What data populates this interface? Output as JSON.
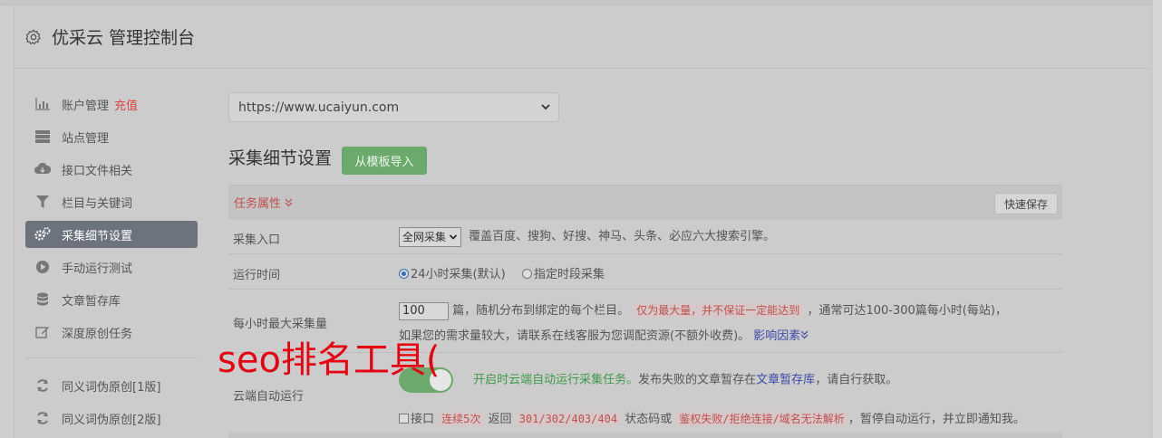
{
  "header": {
    "title": "优采云 管理控制台"
  },
  "sidebar": {
    "items": [
      {
        "label": "账户管理",
        "extra": "充值"
      },
      {
        "label": "站点管理"
      },
      {
        "label": "接口文件相关"
      },
      {
        "label": "栏目与关键词"
      },
      {
        "label": "采集细节设置"
      },
      {
        "label": "手动运行测试"
      },
      {
        "label": "文章暂存库"
      },
      {
        "label": "深度原创任务"
      },
      {
        "label": "同义词伪原创[1版]"
      },
      {
        "label": "同义词伪原创[2版]"
      }
    ]
  },
  "site_select": {
    "value": "https://www.ucaiyun.com"
  },
  "section": {
    "title": "采集细节设置",
    "import_label": "从模板导入"
  },
  "table": {
    "header_label": "任务属性",
    "quick_save": "快速保存",
    "rows": {
      "entry": {
        "label": "采集入口",
        "select_value": "全网采集",
        "desc": "覆盖百度、搜狗、好搜、神马、头条、必应六大搜索引擎。"
      },
      "runtime": {
        "label": "运行时间",
        "opt1": "24小时采集(默认)",
        "opt2": "指定时段采集"
      },
      "max_per_hour": {
        "label": "每小时最大采集量",
        "input_value": "100",
        "text1": "篇，随机分布到绑定的每个栏目。",
        "note": "仅为最大量，并不保证一定能达到",
        "text2": "，通常可达100-300篇每小时(每站)，",
        "text3": "如果您的需求量较大，请联系在线客服为您调配资源(不额外收费)。",
        "link": "影响因素"
      },
      "cloud": {
        "label": "云端自动运行",
        "green": "开启时云端自动运行采集任务。",
        "text1": "发布失败的文章暂存在",
        "link": "文章暂存库",
        "text2": "，请自行获取。",
        "check_label": "接口",
        "code1": "连续5次",
        "text3": "返回",
        "code2": "301/302/403/404",
        "text4": "状态码或",
        "code3": "鉴权失败/拒绝连接/域名无法解析",
        "text5": "，暂停自动运行，并立即通知我。"
      }
    }
  },
  "overlay": {
    "watermark": "seo排名工具("
  }
}
